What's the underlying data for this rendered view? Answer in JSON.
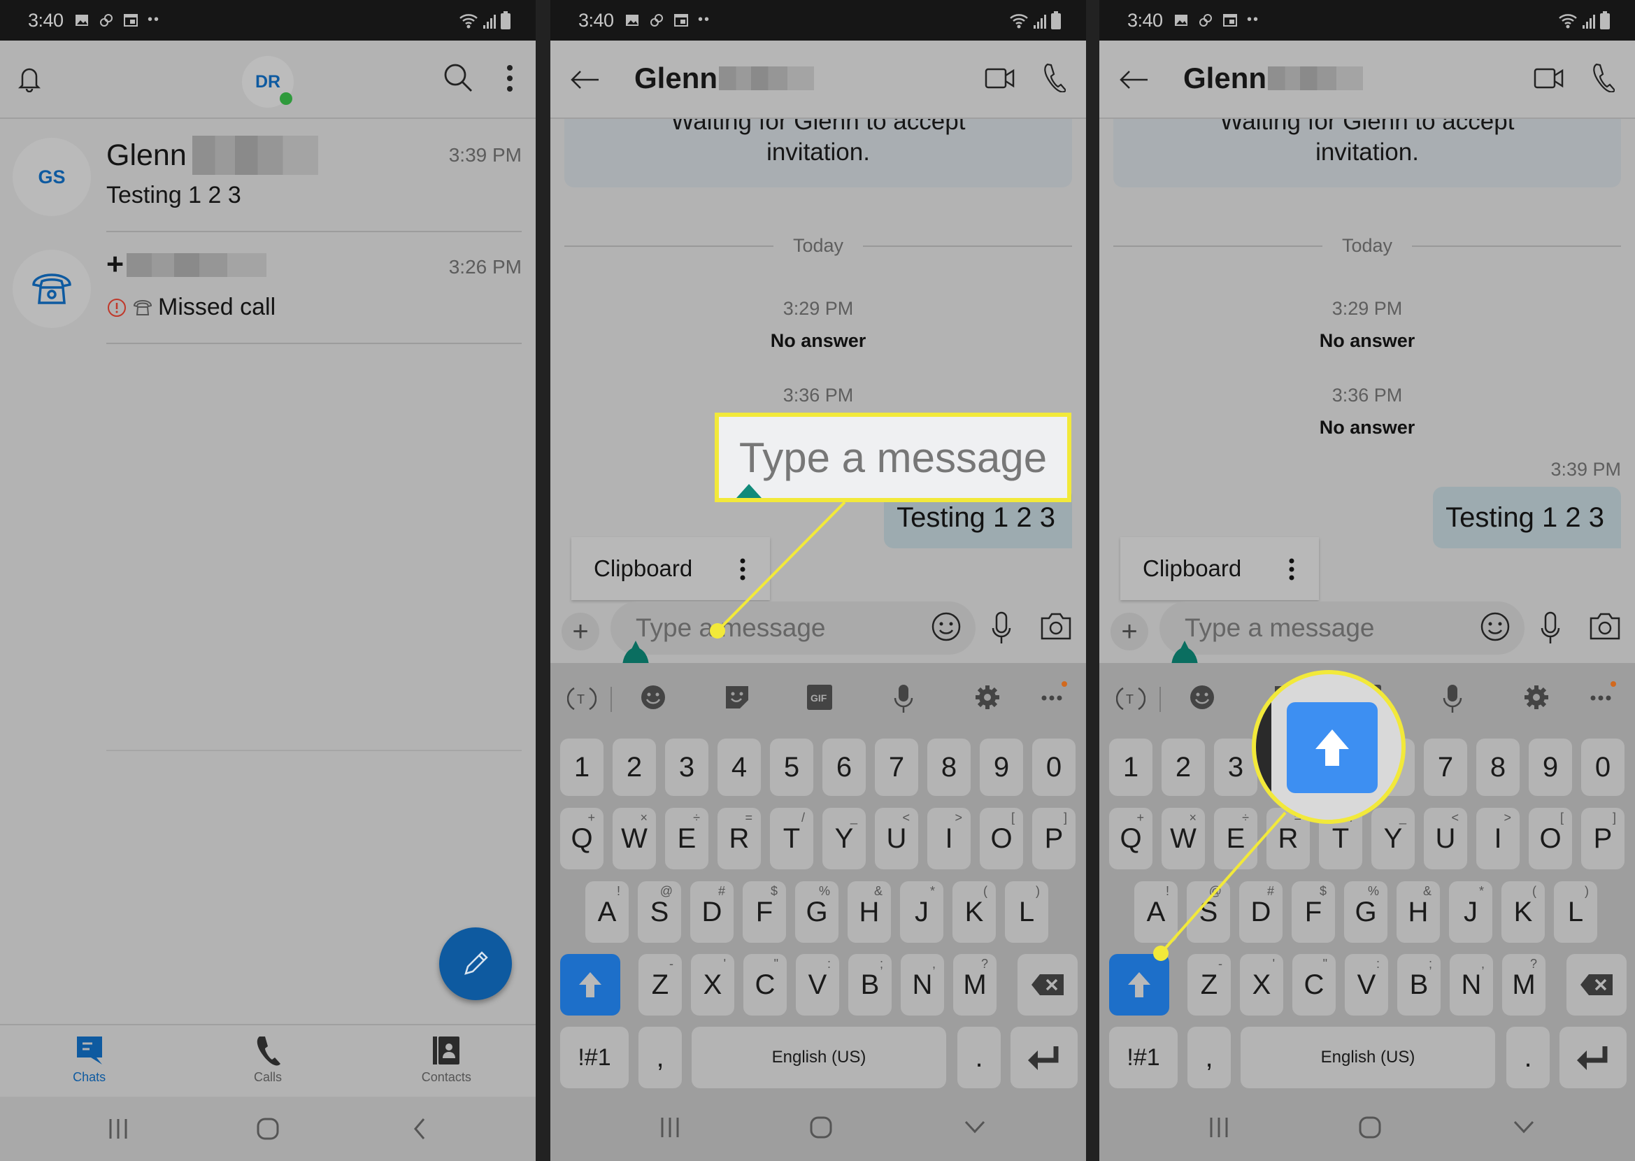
{
  "status_bar": {
    "time": "3:40"
  },
  "panel1": {
    "header": {
      "avatar_initials": "DR"
    },
    "chats": [
      {
        "avatar": "GS",
        "name": "Glenn",
        "time": "3:39 PM",
        "preview": "Testing 1 2 3"
      },
      {
        "avatar_icon": "phone-icon",
        "name": "+",
        "time": "3:26 PM",
        "preview": "Missed call"
      }
    ],
    "bottom_nav": [
      {
        "label": "Chats",
        "icon": "chat-icon",
        "active": true
      },
      {
        "label": "Calls",
        "icon": "phone-icon",
        "active": false
      },
      {
        "label": "Contacts",
        "icon": "contacts-icon",
        "active": false
      }
    ]
  },
  "chat": {
    "title": "Glenn",
    "invite_line1": "Waiting for Glenn to accept",
    "invite_line2": "invitation.",
    "day_separator": "Today",
    "events": [
      {
        "time": "3:29 PM",
        "text": "No answer"
      },
      {
        "time": "3:36 PM",
        "text": "No answer"
      }
    ],
    "outgoing": {
      "time": "3:39 PM",
      "text": "Testing 1 2 3"
    },
    "clipboard_label": "Clipboard",
    "input_placeholder": "Type a message"
  },
  "keyboard": {
    "row_numbers": [
      "1",
      "2",
      "3",
      "4",
      "5",
      "6",
      "7",
      "8",
      "9",
      "0"
    ],
    "row_q": [
      {
        "k": "Q",
        "s": "+"
      },
      {
        "k": "W",
        "s": "×"
      },
      {
        "k": "E",
        "s": "÷"
      },
      {
        "k": "R",
        "s": "="
      },
      {
        "k": "T",
        "s": "/"
      },
      {
        "k": "Y",
        "s": "_"
      },
      {
        "k": "U",
        "s": "<"
      },
      {
        "k": "I",
        "s": ">"
      },
      {
        "k": "O",
        "s": "["
      },
      {
        "k": "P",
        "s": "]"
      }
    ],
    "row_a": [
      {
        "k": "A",
        "s": "!"
      },
      {
        "k": "S",
        "s": "@"
      },
      {
        "k": "D",
        "s": "#"
      },
      {
        "k": "F",
        "s": "$"
      },
      {
        "k": "G",
        "s": "%"
      },
      {
        "k": "H",
        "s": "&"
      },
      {
        "k": "J",
        "s": "*"
      },
      {
        "k": "K",
        "s": "("
      },
      {
        "k": "L",
        "s": ")"
      }
    ],
    "row_z": [
      {
        "k": "Z",
        "s": "-"
      },
      {
        "k": "X",
        "s": "'"
      },
      {
        "k": "C",
        "s": "\""
      },
      {
        "k": "V",
        "s": ":"
      },
      {
        "k": "B",
        "s": ";"
      },
      {
        "k": "N",
        "s": ","
      },
      {
        "k": "M",
        "s": "?"
      }
    ],
    "symbols_key": "!#1",
    "comma_key": ",",
    "space_label": "English (US)",
    "period_key": "."
  },
  "callouts": {
    "middle_zoom_text": "Type a message",
    "highlight_color": "#f2e93a"
  },
  "colors": {
    "brand_blue": "#0e5aa0",
    "shift_blue": "#1d6fc9",
    "presence_green": "#2f9a3c",
    "missed_red": "#c0392b"
  }
}
